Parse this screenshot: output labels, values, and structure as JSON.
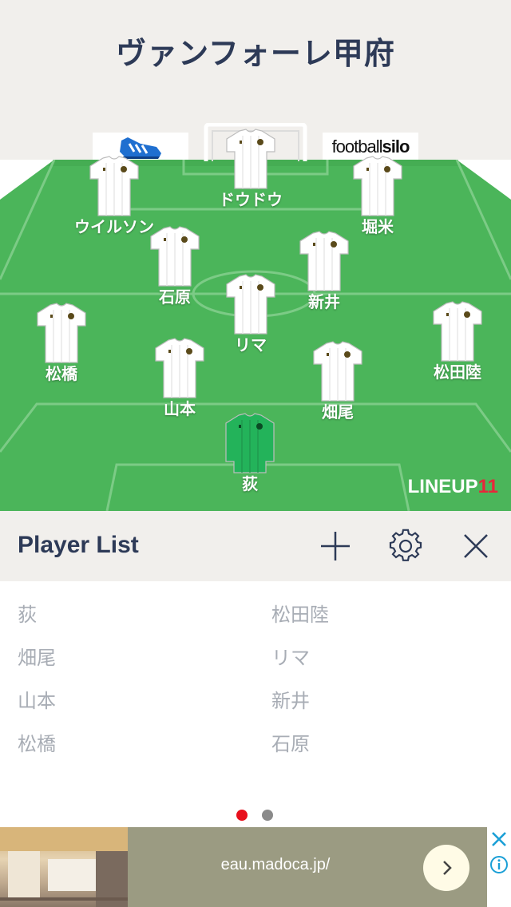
{
  "team": {
    "title": "ヴァンフォーレ甲府"
  },
  "sponsors": {
    "right_text_light": "football",
    "right_text_bold": "silo"
  },
  "formation_players": [
    {
      "name": "ドウドウ",
      "kit": "outfield"
    },
    {
      "name": "ウイルソン",
      "kit": "outfield"
    },
    {
      "name": "堀米",
      "kit": "outfield"
    },
    {
      "name": "石原",
      "kit": "outfield"
    },
    {
      "name": "新井",
      "kit": "outfield"
    },
    {
      "name": "リマ",
      "kit": "outfield"
    },
    {
      "name": "松橋",
      "kit": "outfield"
    },
    {
      "name": "松田陸",
      "kit": "outfield"
    },
    {
      "name": "山本",
      "kit": "outfield"
    },
    {
      "name": "畑尾",
      "kit": "outfield"
    },
    {
      "name": "荻",
      "kit": "goalkeeper"
    }
  ],
  "brand": {
    "text": "LINEUP",
    "num": "11"
  },
  "player_list": {
    "title": "Player List",
    "left_column": [
      "荻",
      "畑尾",
      "山本",
      "松橋"
    ],
    "right_column": [
      "松田陸",
      "リマ",
      "新井",
      "石原"
    ]
  },
  "pager": {
    "total": 2,
    "active": 1
  },
  "ad": {
    "url": "eau.madoca.jp/"
  },
  "colors": {
    "pitch": "#4bb55a",
    "pitch_lines": "#7ccb86",
    "title": "#2d3a57",
    "gk_kit": "#23b35a",
    "active_dot": "#e8101c",
    "inactive_dot": "#8a8a8a",
    "brand_accent": "#e8263a"
  }
}
